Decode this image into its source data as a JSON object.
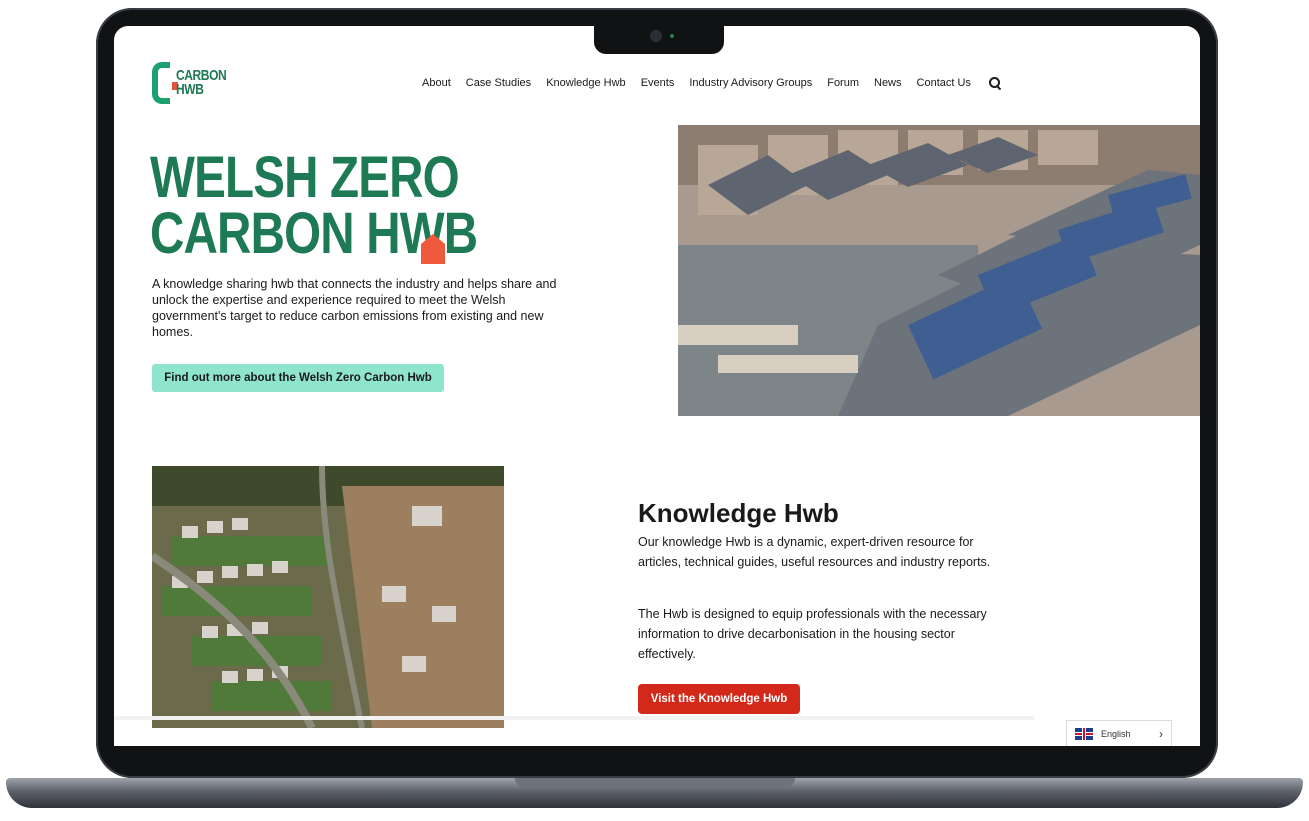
{
  "brand": {
    "logo_line1": "CARBON",
    "logo_line2": "HWB",
    "primary_green": "#1d7a55",
    "accent_red": "#d3291a",
    "accent_mint": "#8fe5cc",
    "accent_orange": "#ef5a3c"
  },
  "nav": {
    "items": [
      "About",
      "Case Studies",
      "Knowledge Hwb",
      "Events",
      "Industry Advisory Groups",
      "Forum",
      "News",
      "Contact Us"
    ],
    "search_icon": "search-icon"
  },
  "hero": {
    "title_line1": "WELSH ZERO",
    "title_line2": "CARBON HWB",
    "description": "A knowledge sharing hwb that connects the industry and helps share and unlock the expertise and experience required to meet the Welsh government's target to reduce carbon emissions from existing and new homes.",
    "cta_label": "Find out more about the Welsh Zero Carbon Hwb"
  },
  "knowledge": {
    "title": "Knowledge Hwb",
    "paragraph1": "Our knowledge Hwb is a dynamic, expert-driven resource for articles, technical guides, useful resources and industry reports.",
    "paragraph2": "The Hwb is designed to equip professionals with the necessary information to drive decarbonisation in the housing sector effectively.",
    "cta_label": "Visit the Knowledge Hwb"
  },
  "language": {
    "selected": "English",
    "flag_icon": "uk-flag-icon",
    "chevron_icon": "chevron-right-icon"
  }
}
